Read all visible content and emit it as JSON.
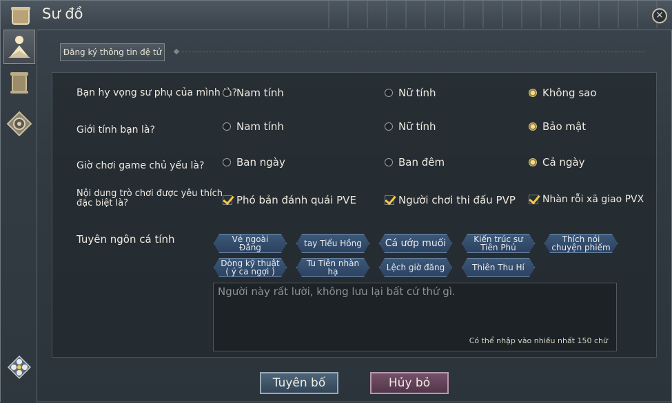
{
  "window": {
    "title": "Sư đồ",
    "close_symbol": "×"
  },
  "sidebar": {
    "items": [
      {
        "icon": "master-disciple-icon",
        "active": true
      },
      {
        "icon": "scroll-icon",
        "active": false
      },
      {
        "icon": "emblem-icon",
        "active": false
      }
    ],
    "bottom_icon": "settings-flower-icon"
  },
  "section": {
    "tab_label": "Đăng ký thông tin đệ tử"
  },
  "questions": [
    {
      "label": "Bạn hy vọng sư phụ của mình là?",
      "options": [
        "Nam tính",
        "Nữ tính",
        "Không sao"
      ],
      "selected": 2
    },
    {
      "label": "Giới tính bạn là?",
      "options": [
        "Nam tính",
        "Nữ tính",
        "Bảo mật"
      ],
      "selected": 2
    },
    {
      "label": "Giờ chơi game chủ yếu là?",
      "options": [
        "Ban ngày",
        "Ban đêm",
        "Cả ngày"
      ],
      "selected": 2
    }
  ],
  "preferences": {
    "label_line1": "Nội dung trò chơi được yêu thích",
    "label_line2": "đặc biệt là?",
    "options": [
      "Phó bản đánh quái PVE",
      "Người chơi thi đấu PVP",
      "Nhàn rỗi xã giao PVX"
    ],
    "checked": [
      true,
      true,
      true
    ]
  },
  "motto": {
    "label": "Tuyên ngôn cá tính",
    "tags": [
      [
        "Vẻ ngoài",
        "Đẳng"
      ],
      [
        "tay Tiểu Hồng"
      ],
      [
        "Cá ướp muối"
      ],
      [
        "Kiến trúc sư",
        "Tiên Phủ"
      ],
      [
        "Thích nói",
        "chuyện phiếm"
      ],
      [
        "Dòng kỹ thuật",
        "( ý ca ngợi )"
      ],
      [
        "Tu Tiên nhàn",
        "hạ"
      ],
      [
        "Lệch giờ đăng"
      ],
      [
        "Thiên Thu Hí"
      ]
    ],
    "placeholder": "Người này rất lười, không lưu lại bất cứ thứ gì.",
    "counter": "Có thể nhập vào nhiều nhất 150 chữ"
  },
  "buttons": {
    "confirm": "Tuyên bố",
    "cancel": "Hủy bỏ"
  },
  "colors": {
    "selected_radio": "#f3d98a",
    "checkmark": "#f2c94c",
    "tag_bg": "#3c5878",
    "cancel_bg": "#74506a"
  }
}
